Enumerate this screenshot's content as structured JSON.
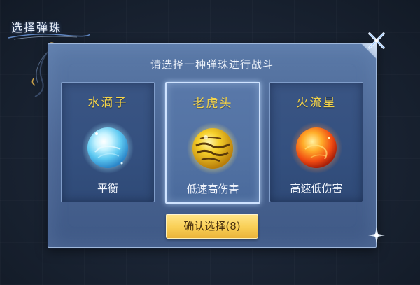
{
  "dialog": {
    "title": "选择弹珠",
    "prompt": "请选择一种弹珠进行战斗",
    "confirm_label": "确认选择(8)"
  },
  "marbles": [
    {
      "name": "水滴子",
      "description": "平衡",
      "selected": false,
      "orb_color": "#8fe4ff"
    },
    {
      "name": "老虎头",
      "description": "低速高伤害",
      "selected": true,
      "orb_color": "#f2c21e"
    },
    {
      "name": "火流星",
      "description": "高速低伤害",
      "selected": false,
      "orb_color": "#ff6a1a"
    }
  ],
  "colors": {
    "panel": "#4f6b9a",
    "card_title": "#f4d44a",
    "button": "#f9cf55"
  },
  "icons": {
    "close": "close-icon",
    "sparkle": "sparkle-icon"
  }
}
